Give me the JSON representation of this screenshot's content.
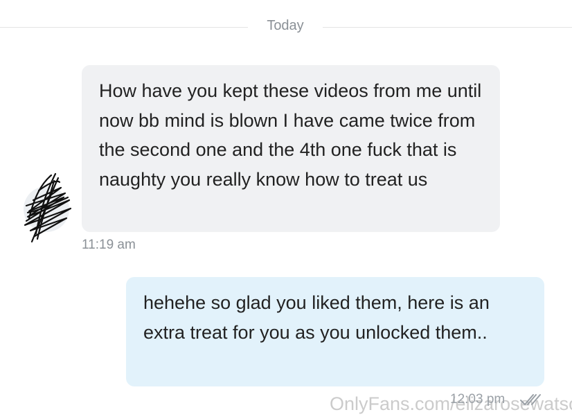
{
  "chat": {
    "date_divider": "Today",
    "messages": [
      {
        "direction": "incoming",
        "text": "How have you kept these videos from me until now bb mind is blown I have came twice from the second one and the 4th one fuck that is naughty you really know how to treat us",
        "time": "11:19 am"
      },
      {
        "direction": "outgoing",
        "text": "hehehe so glad you liked them, here is an extra treat for you as you unlocked them..",
        "time": "12:03 pm",
        "status_icon": "double-check-icon"
      }
    ]
  },
  "watermark": "OnlyFans.com/elizarosewatson",
  "colors": {
    "incoming_bubble": "#f0f1f3",
    "outgoing_bubble": "#e2f2fb",
    "meta_text": "#8a9096"
  }
}
